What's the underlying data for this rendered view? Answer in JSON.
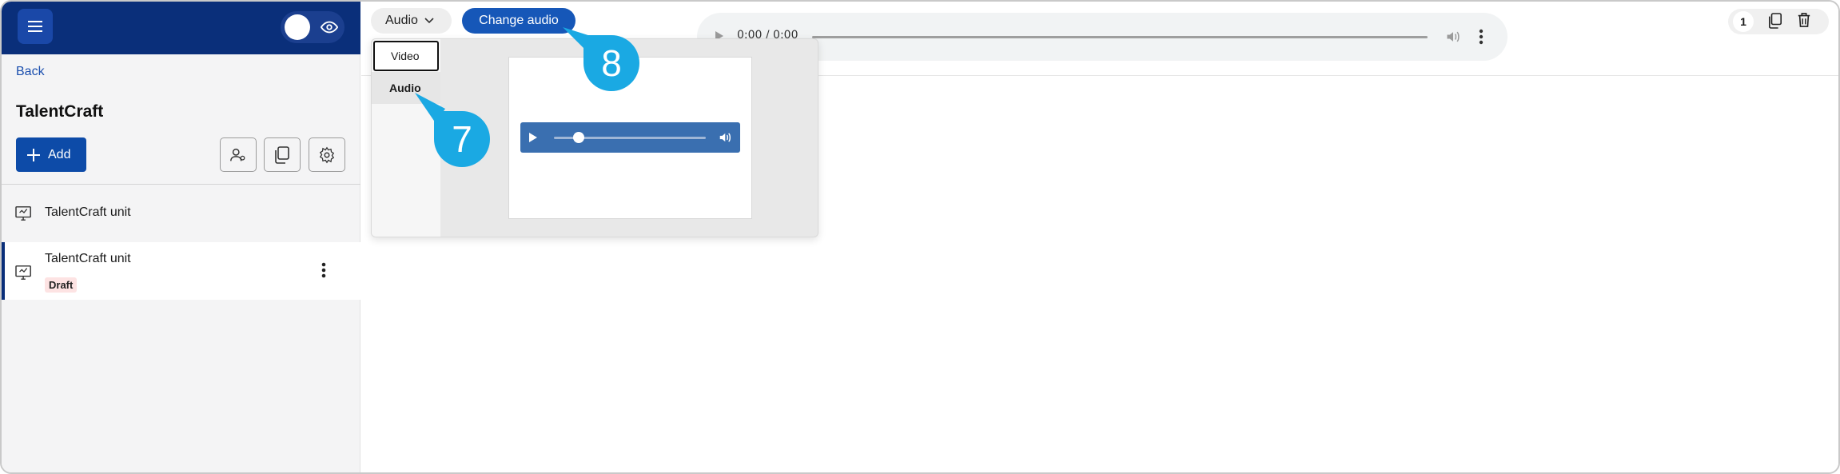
{
  "sidebar": {
    "back_label": "Back",
    "course_title": "TalentCraft",
    "add_label": "Add",
    "units": [
      {
        "label": "TalentCraft unit",
        "badge": ""
      },
      {
        "label": "TalentCraft unit",
        "badge": "Draft"
      }
    ]
  },
  "toolbar": {
    "media_type_selected": "Audio",
    "change_button_label": "Change audio",
    "page_number": "1"
  },
  "player": {
    "time": "0:00 / 0:00"
  },
  "dropdown": {
    "options": [
      "Video",
      "Audio"
    ]
  },
  "callouts": {
    "step_7": "7",
    "step_8": "8"
  },
  "colors": {
    "topbar": "#0a2f7a",
    "primary": "#0d4ba8",
    "callout": "#1aa9e3",
    "draft_badge_bg": "#fde3e3"
  }
}
